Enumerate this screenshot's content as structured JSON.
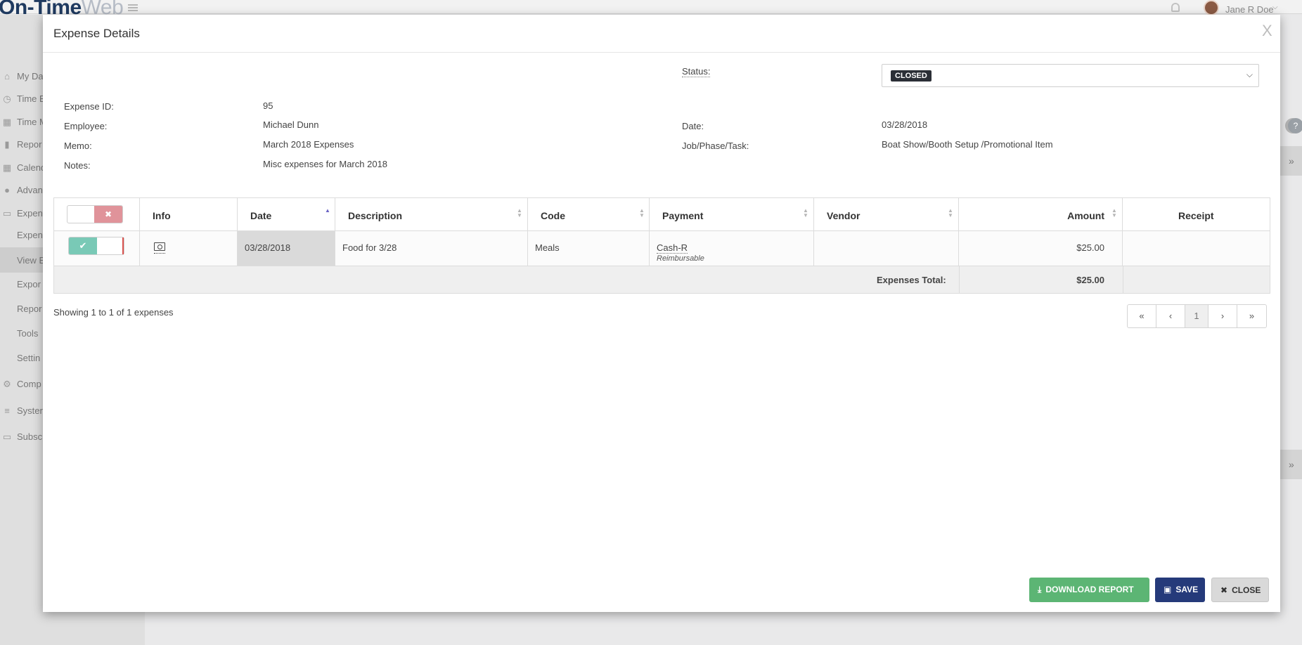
{
  "app": {
    "logo_main": "On-Time",
    "logo_sub": "Web",
    "user_name": "Jane R Doe",
    "user_caret": "⌵"
  },
  "sidebar": {
    "items": [
      {
        "icon": "⌂",
        "label": "My Da"
      },
      {
        "icon": "◷",
        "label": "Time E"
      },
      {
        "icon": "▦",
        "label": "Time M"
      },
      {
        "icon": "▮",
        "label": "Repor"
      },
      {
        "icon": "▦",
        "label": "Calend"
      },
      {
        "icon": "●",
        "label": "Advan"
      },
      {
        "icon": "▭",
        "label": "Expen"
      },
      {
        "icon": "",
        "label": "Expen"
      },
      {
        "icon": "",
        "label": "View E"
      },
      {
        "icon": "",
        "label": "Expor"
      },
      {
        "icon": "",
        "label": "Repor"
      },
      {
        "icon": "",
        "label": "Tools"
      },
      {
        "icon": "",
        "label": "Settin"
      },
      {
        "icon": "⚙",
        "label": "Comp"
      },
      {
        "icon": "≡",
        "label": "Syster"
      },
      {
        "icon": "▭",
        "label": "Subsc"
      }
    ]
  },
  "right_rail": {
    "help_icon": "?",
    "arrow_icon": "»"
  },
  "modal": {
    "title": "Expense Details",
    "close_x": "X",
    "status_label": "Status:",
    "status_value": "CLOSED",
    "status_caret": "⌵",
    "fields": {
      "expense_id_label": "Expense ID:",
      "expense_id_value": "95",
      "employee_label": "Employee:",
      "employee_value": "Michael Dunn",
      "memo_label": "Memo:",
      "memo_value": "March 2018 Expenses",
      "notes_label": "Notes:",
      "notes_value": "Misc expenses for March 2018",
      "date_label": "Date:",
      "date_value": "03/28/2018",
      "job_label": "Job/Phase/Task:",
      "job_value": "Boat Show/Booth Setup /Promotional Item"
    },
    "table": {
      "header_toggle_icon": "✖",
      "columns": {
        "info": "Info",
        "date": "Date",
        "description": "Description",
        "code": "Code",
        "payment": "Payment",
        "vendor": "Vendor",
        "amount": "Amount",
        "receipt": "Receipt"
      },
      "sort_up": "▲",
      "sort_down": "▼",
      "rows": [
        {
          "toggle_icon": "✔",
          "date": "03/28/2018",
          "description": "Food for 3/28",
          "code": "Meals",
          "payment": "Cash-R",
          "payment_note": "Reimbursable",
          "vendor": "",
          "amount": "$25.00",
          "receipt": ""
        }
      ],
      "total_label": "Expenses Total:",
      "total_value": "$25.00"
    },
    "showing_text": "Showing 1 to 1 of 1 expenses",
    "pager": {
      "first": "«",
      "prev": "‹",
      "current": "1",
      "next": "›",
      "last": "»"
    },
    "buttons": {
      "download_icon": "⤓",
      "download": "DOWNLOAD REPORT",
      "save_icon": "▣",
      "save": "SAVE",
      "close_icon": "✖",
      "close": "CLOSE"
    }
  },
  "colors": {
    "download_button": "#5cb574",
    "save_button": "#253a7a",
    "status_badge": "#2b2f36",
    "toggle_on": "#79c9b6",
    "toggle_off": "#e0939a",
    "logo": "#1f3a60"
  }
}
